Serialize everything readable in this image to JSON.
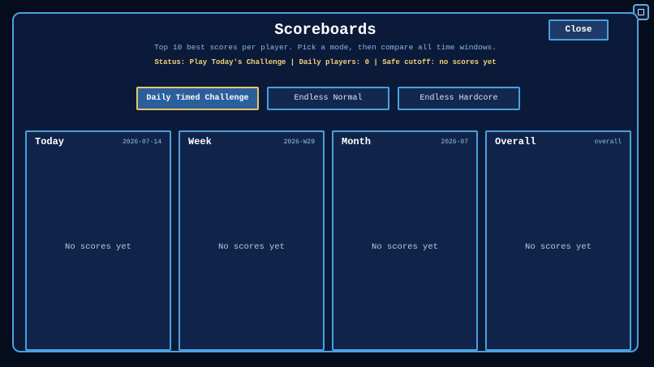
{
  "header": {
    "title": "Scoreboards",
    "subtitle": "Top 10 best scores per player. Pick a mode, then compare all time windows.",
    "status": "Status: Play Today's Challenge | Daily players: 0 | Safe cutoff: no scores yet",
    "close_label": "Close"
  },
  "modes": [
    {
      "label": "Daily Timed Challenge",
      "active": true
    },
    {
      "label": "Endless Normal",
      "active": false
    },
    {
      "label": "Endless Hardcore",
      "active": false
    }
  ],
  "boards": [
    {
      "title": "Today",
      "period": "2026-07-14",
      "empty": "No scores yet"
    },
    {
      "title": "Week",
      "period": "2026-W29",
      "empty": "No scores yet"
    },
    {
      "title": "Month",
      "period": "2026-07",
      "empty": "No scores yet"
    },
    {
      "title": "Overall",
      "period": "overall",
      "empty": "No scores yet"
    }
  ],
  "colors": {
    "accent": "#4aa0e0",
    "active_border": "#e8c66a",
    "status_text": "#f3d27a",
    "panel_bg": "#0b1a38"
  },
  "icons": {
    "corner": "window-toggle-icon"
  }
}
